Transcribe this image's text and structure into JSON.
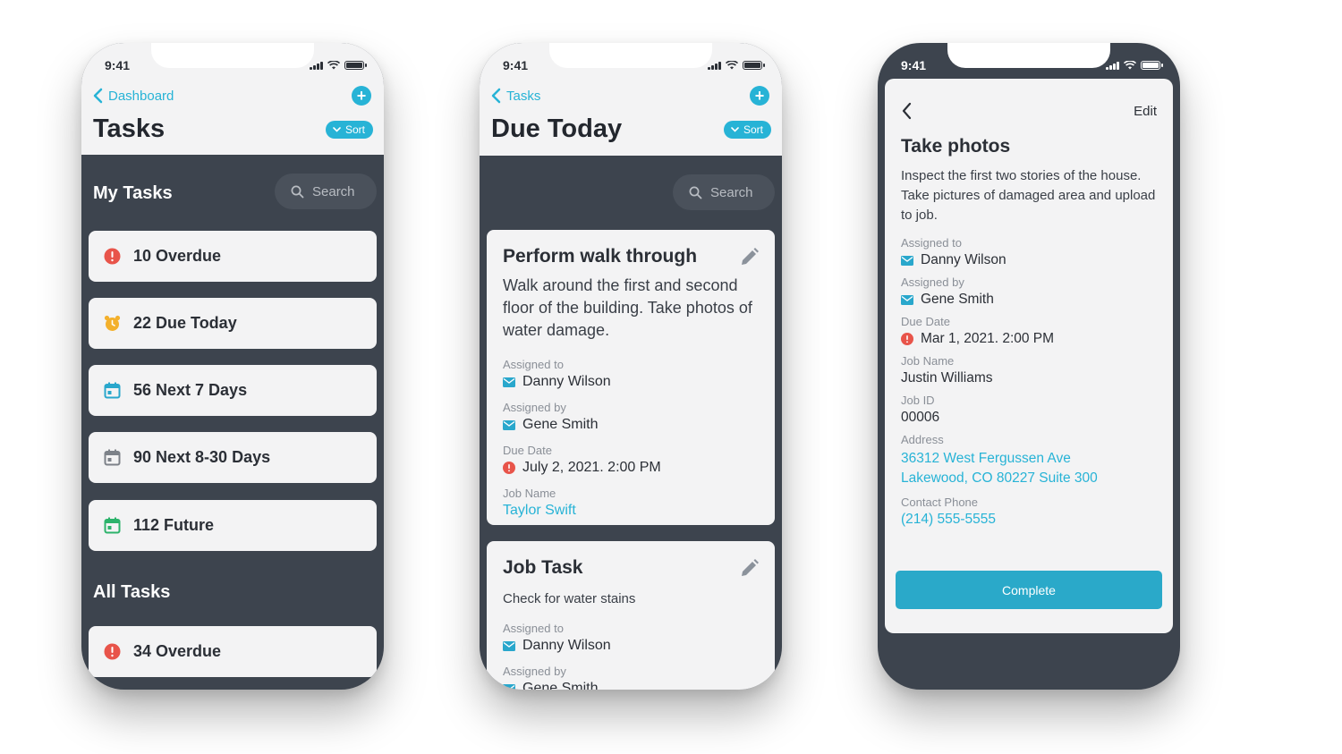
{
  "colors": {
    "accent": "#27b3d6",
    "dark": "#3d444e",
    "card": "#f3f3f4",
    "error": "#e8544a",
    "warn": "#f3b02c",
    "calendar": "#29a7cc",
    "calendar_gray": "#7d8289",
    "calendar_green": "#2cb36b"
  },
  "screen1": {
    "time": "9:41",
    "back_label": "Dashboard",
    "title": "Tasks",
    "sort_label": "Sort",
    "section_my": "My Tasks",
    "search_placeholder": "Search",
    "items": [
      {
        "label": "10 Overdue",
        "icon": "alert-icon"
      },
      {
        "label": "22 Due Today",
        "icon": "alarm-clock-icon"
      },
      {
        "label": "56 Next 7 Days",
        "icon": "calendar-icon"
      },
      {
        "label": "90 Next 8-30 Days",
        "icon": "calendar-icon"
      },
      {
        "label": "112 Future",
        "icon": "calendar-icon"
      }
    ],
    "section_all": "All Tasks",
    "all_items": [
      {
        "label": "34 Overdue",
        "icon": "alert-icon"
      }
    ]
  },
  "screen2": {
    "time": "9:41",
    "back_label": "Tasks",
    "title": "Due Today",
    "sort_label": "Sort",
    "search_placeholder": "Search",
    "cards": [
      {
        "title": "Perform walk through",
        "description": "Walk around the first and second floor of the building. Take photos of water damage.",
        "assigned_to_label": "Assigned to",
        "assigned_to": "Danny Wilson",
        "assigned_by_label": "Assigned by",
        "assigned_by": "Gene Smith",
        "due_label": "Due Date",
        "due": "July 2, 2021. 2:00 PM",
        "job_label": "Job Name",
        "job": "Taylor Swift"
      },
      {
        "title": "Job Task",
        "description": "Check for water stains",
        "assigned_to_label": "Assigned to",
        "assigned_to": "Danny Wilson",
        "assigned_by_label": "Assigned by",
        "assigned_by": "Gene Smith"
      }
    ]
  },
  "screen3": {
    "time": "9:41",
    "edit_label": "Edit",
    "title": "Take photos",
    "description": "Inspect the first two stories of the house.  Take pictures of damaged area and upload to job.",
    "assigned_to_label": "Assigned to",
    "assigned_to": "Danny Wilson",
    "assigned_by_label": "Assigned by",
    "assigned_by": "Gene Smith",
    "due_label": "Due Date",
    "due": "Mar 1, 2021. 2:00 PM",
    "job_name_label": "Job Name",
    "job_name": "Justin Williams",
    "job_id_label": "Job ID",
    "job_id": "00006",
    "address_label": "Address",
    "address_line1": "36312 West Fergussen Ave",
    "address_line2": "Lakewood, CO 80227 Suite 300",
    "phone_label": "Contact Phone",
    "phone": "(214) 555-5555",
    "complete_label": "Complete"
  }
}
